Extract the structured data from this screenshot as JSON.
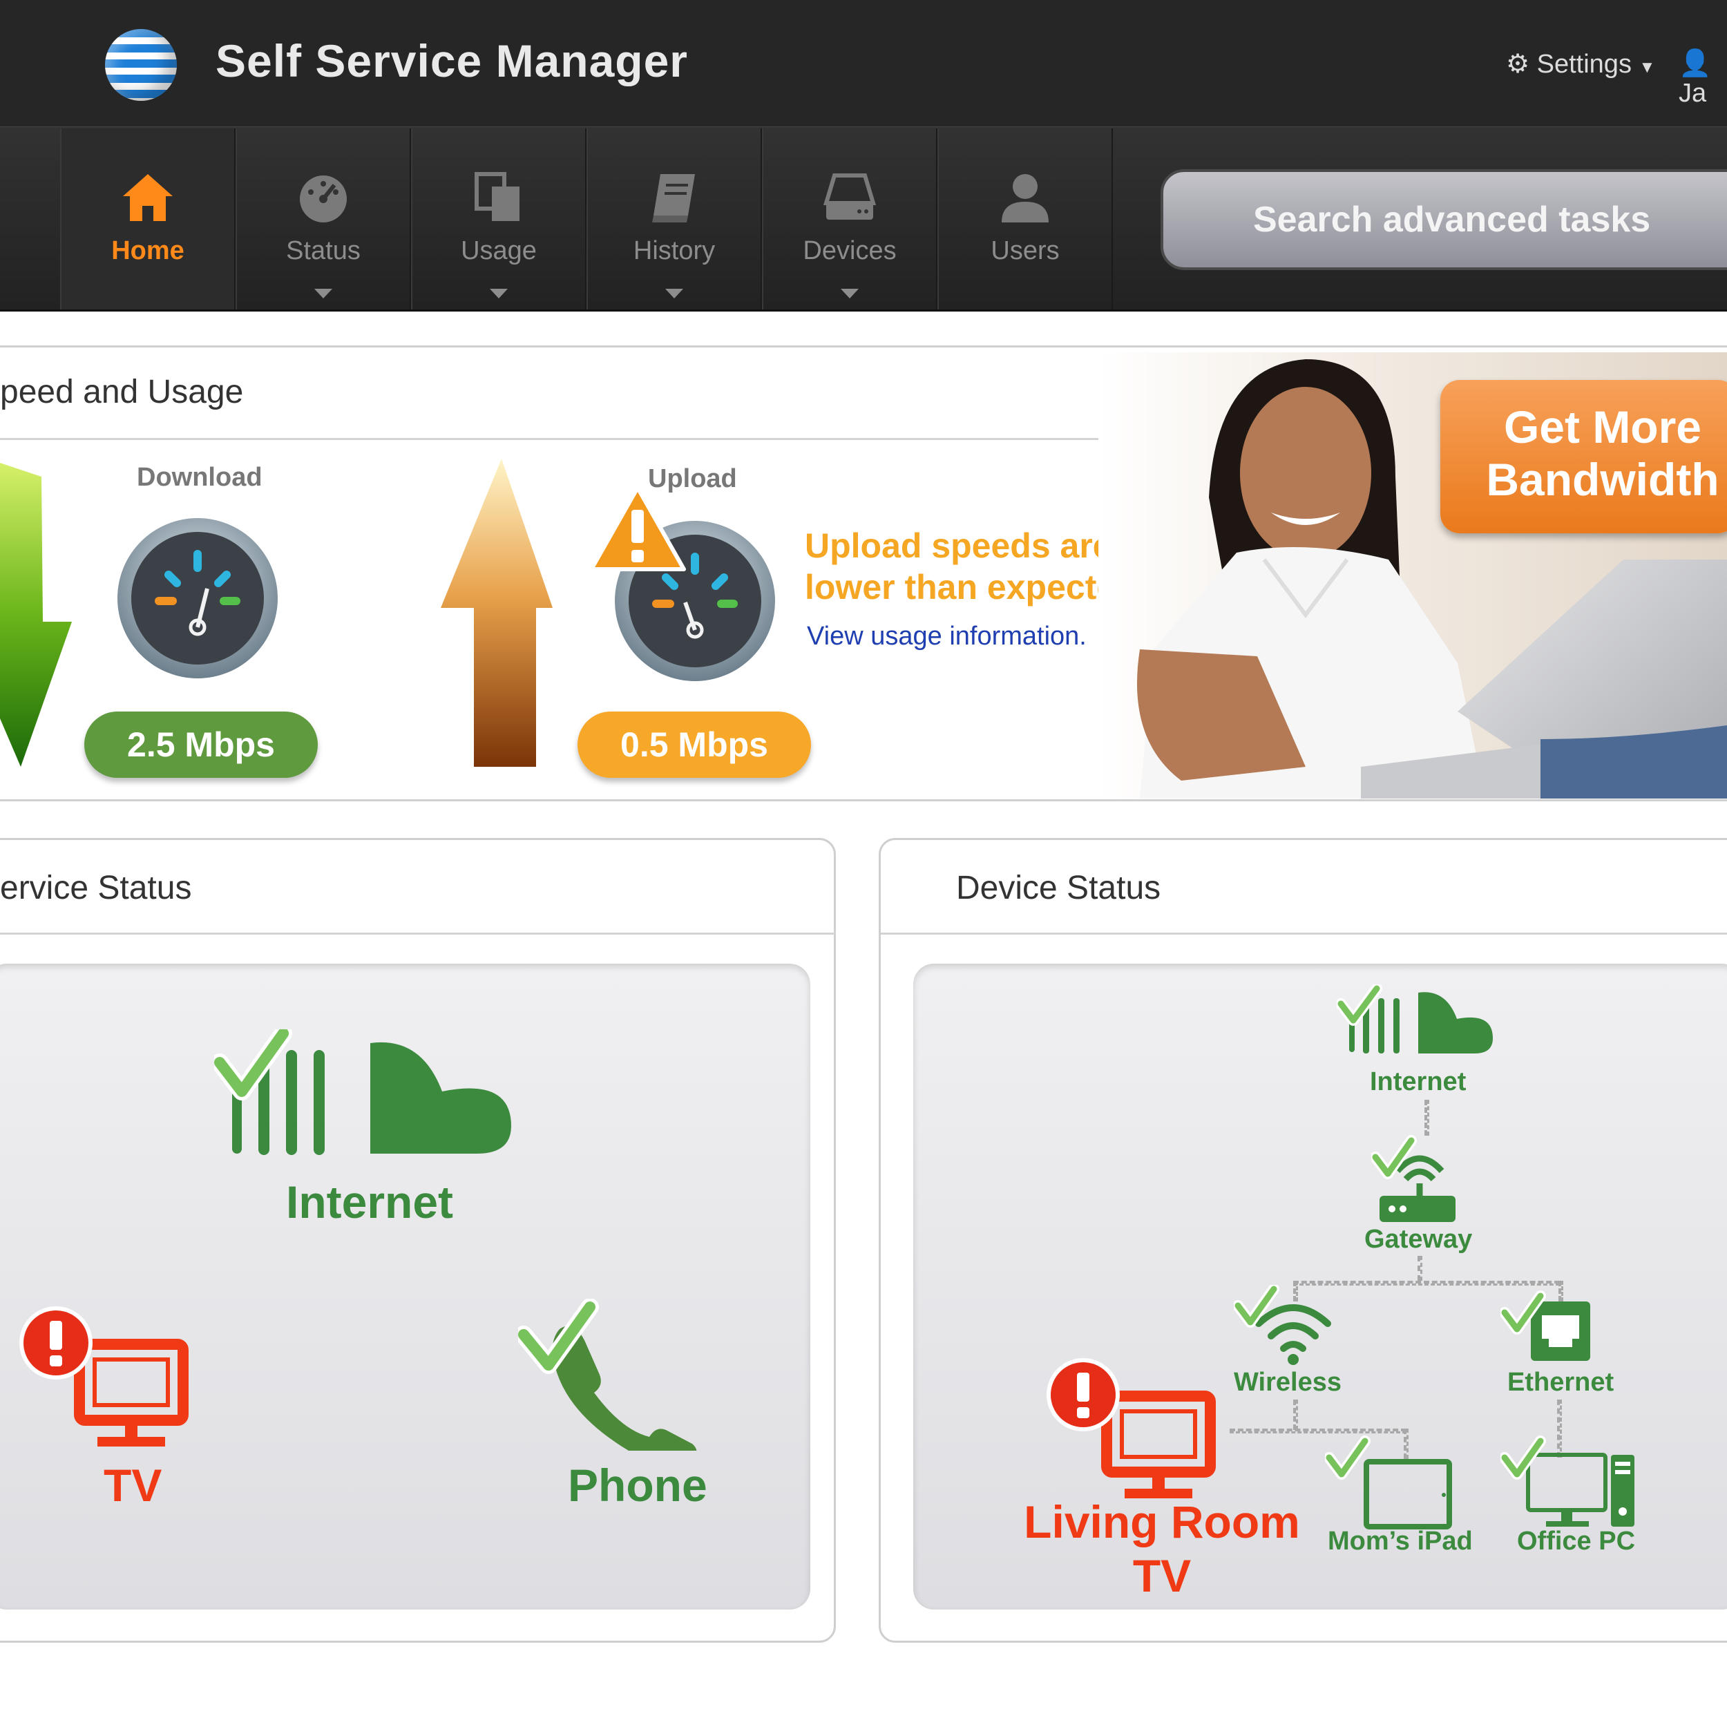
{
  "header": {
    "title": "Self Service Manager",
    "settings_label": "Settings",
    "user_label": "Ja"
  },
  "nav": [
    {
      "label": "Home",
      "icon": "home-icon"
    },
    {
      "label": "Status",
      "icon": "speedometer-icon"
    },
    {
      "label": "Usage",
      "icon": "copy-icon"
    },
    {
      "label": "History",
      "icon": "book-icon"
    },
    {
      "label": "Devices",
      "icon": "hard-drive-icon"
    },
    {
      "label": "Users",
      "icon": "user-icon"
    }
  ],
  "search": {
    "placeholder": "Search advanced tasks"
  },
  "speed": {
    "title": "peed and Usage",
    "download_label": "Download",
    "download_value": "2.5 Mbps",
    "upload_label": "Upload",
    "upload_value": "0.5 Mbps",
    "warning": "Upload speeds are\nlower than expected!",
    "link": "View usage information.",
    "promo": "Get More\nBandwidth"
  },
  "service_status": {
    "title": "ervice Status",
    "internet_label": "Internet",
    "tv_label": "TV",
    "phone_label": "Phone"
  },
  "device_status": {
    "title": "Device Status",
    "internet_label": "Internet",
    "gateway_label": "Gateway",
    "wireless_label": "Wireless",
    "ethernet_label": "Ethernet",
    "tv_label_1": "Living Room",
    "tv_label_2": "TV",
    "ipad_label": "Mom’s iPad",
    "pc_label": "Office PC"
  },
  "colors": {
    "accent": "#ff8a1a",
    "ok_green": "#3b8a3e",
    "error_red": "#f03a16",
    "warning": "#f5a623"
  }
}
